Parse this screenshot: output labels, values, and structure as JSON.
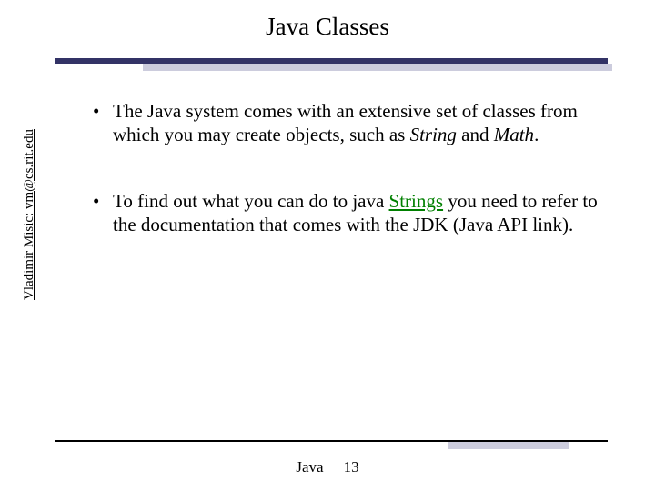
{
  "title": "Java Classes",
  "sidebar": "Vladimir Misic: vm@cs.rit.edu",
  "bullets": [
    {
      "pre": "The Java system comes with an extensive set of classes from which you may create objects, such as ",
      "i1": "String",
      "mid": " and ",
      "i2": "Math",
      "post": "."
    },
    {
      "pre": "To find out what you can do to java ",
      "link": "Strings",
      "post": " you need to refer to the documentation that comes with the JDK (Java API link)."
    }
  ],
  "footer": {
    "label": "Java",
    "page": "13"
  }
}
